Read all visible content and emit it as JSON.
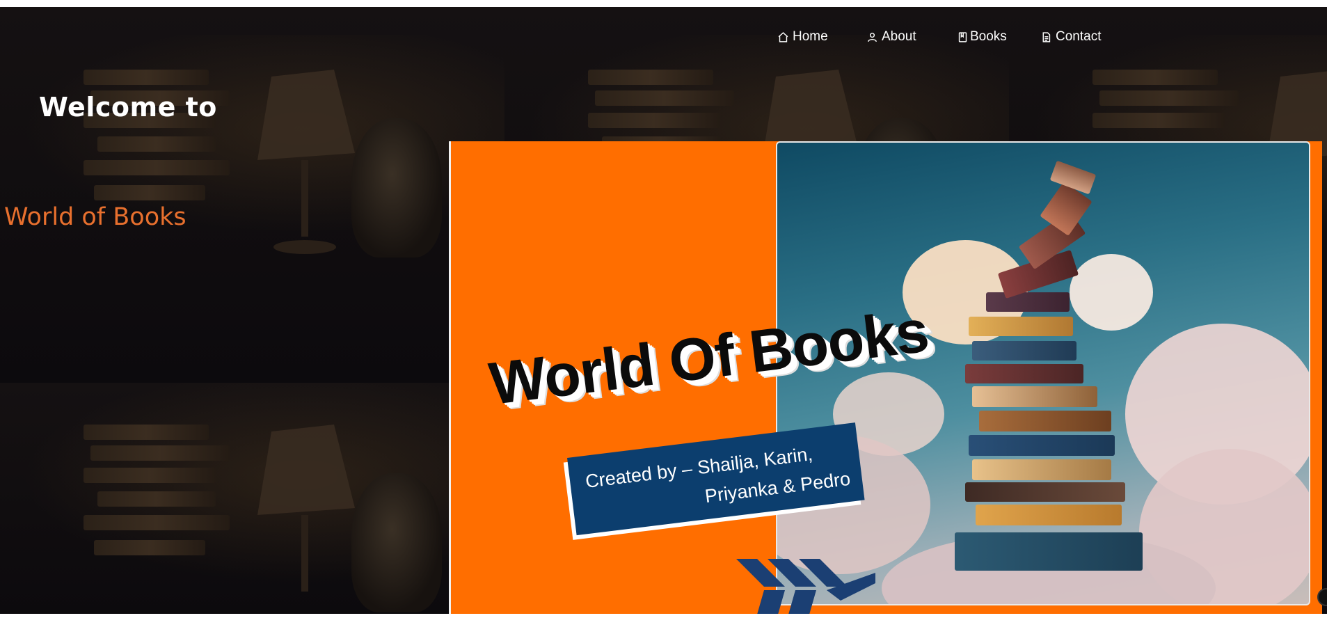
{
  "nav": {
    "items": [
      {
        "label": "Home",
        "icon": "home-icon"
      },
      {
        "label": "About",
        "icon": "user-icon"
      },
      {
        "label": "Books",
        "icon": "book-icon"
      },
      {
        "label": "Contact",
        "icon": "document-icon"
      }
    ]
  },
  "hero_text": {
    "welcome": "Welcome to",
    "brand": "World of Books"
  },
  "banner": {
    "title": "World Of Books",
    "credit_line1": "Created by – Shailja, Karin,",
    "credit_line2": "Priyanka & Pedro"
  },
  "colors": {
    "background": "#0d0a0e",
    "accent_orange": "#ff6e00",
    "brand_text": "#e8702e",
    "credit_box": "#0c3e6e"
  }
}
